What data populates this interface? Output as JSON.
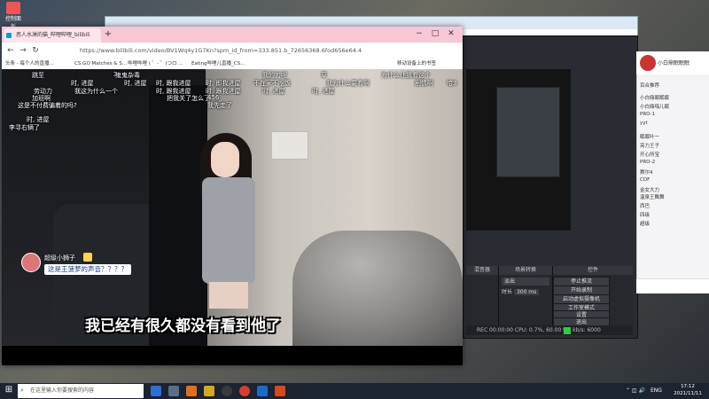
{
  "desktop": {
    "icon_label": "控制面板"
  },
  "browser": {
    "tab_title": "恶人水淋的猫_哔哩哔哩_bilibili",
    "new_tab": "+",
    "url": "https://www.bilibili.com/video/BV1Wq4y1G7Kn?spm_id_from=333.851.b_72656368.6fod656e64.4",
    "bookmarks": [
      "头条 - 每个人的直播...",
      "CS:GO Matches & S...",
      "哔哩哔哩 ( ゜- ゜)つロ ...",
      "Eating哔哩儿直播_CS...",
      "移动设备上的书签"
    ],
    "controls": {
      "minimize": "−",
      "maximize": "□",
      "close": "✕",
      "back": "←",
      "forward": "→",
      "refresh": "↻"
    }
  },
  "video": {
    "danmaku": [
      "鬼鬼杂毒",
      "我的刀呢",
      "草",
      "为什么让我看这个",
      "3",
      "不在家不吃饭",
      "我为什么要看啊",
      "跳至",
      "时, 进屋",
      "时, 进屋",
      "时, 跟我进屋",
      "时, 即我进屋",
      "剧情啊",
      "哈3",
      "劳动力",
      "我这为什么一个",
      "时, 跟我进屋",
      "时, 跟我进屋",
      "时, 进屋",
      "时, 进屋",
      "加班啊",
      "把我关了怎么了",
      "456",
      "我先走了",
      "这是不付费骗着的吗?",
      "时, 进屋",
      "李寻右辆了"
    ],
    "gift_user": "超级小狮子",
    "gift_message": "这是王菠萝的声音？？？？",
    "subtitle": "我已经有很久都没有看到他了"
  },
  "obs": {
    "dock_headers": [
      "场景",
      "源",
      "混音器",
      "场景转换",
      "控件"
    ],
    "transition": "淡出",
    "duration_label": "时长",
    "duration_value": "300 ms",
    "controls": [
      "停止推流",
      "开始录制",
      "启动虚拟摄像机",
      "工作室模式",
      "设置",
      "退出"
    ],
    "status": "REC 00:00:00   CPU: 0.7%, 60.00 fps   kb/s: 6000"
  },
  "chat": {
    "title": "小白鼎眠眠眠",
    "lines": [
      "百合推荐",
      "小白鼎眠眠眠",
      "小白鼎嗨儿眠",
      "PRO-1",
      "yyt",
      "眠眠叶一",
      "亮力王子",
      "开心所宝",
      "PRO-2",
      "赛尔4",
      "CDF",
      "金女大力",
      "温泉王舞舞",
      "西巴",
      "四级",
      "超级"
    ]
  },
  "taskbar": {
    "search_placeholder": "在这里输入你要搜索的内容",
    "ime": "ENG",
    "time": "17:12",
    "date": "2021/11/11"
  }
}
